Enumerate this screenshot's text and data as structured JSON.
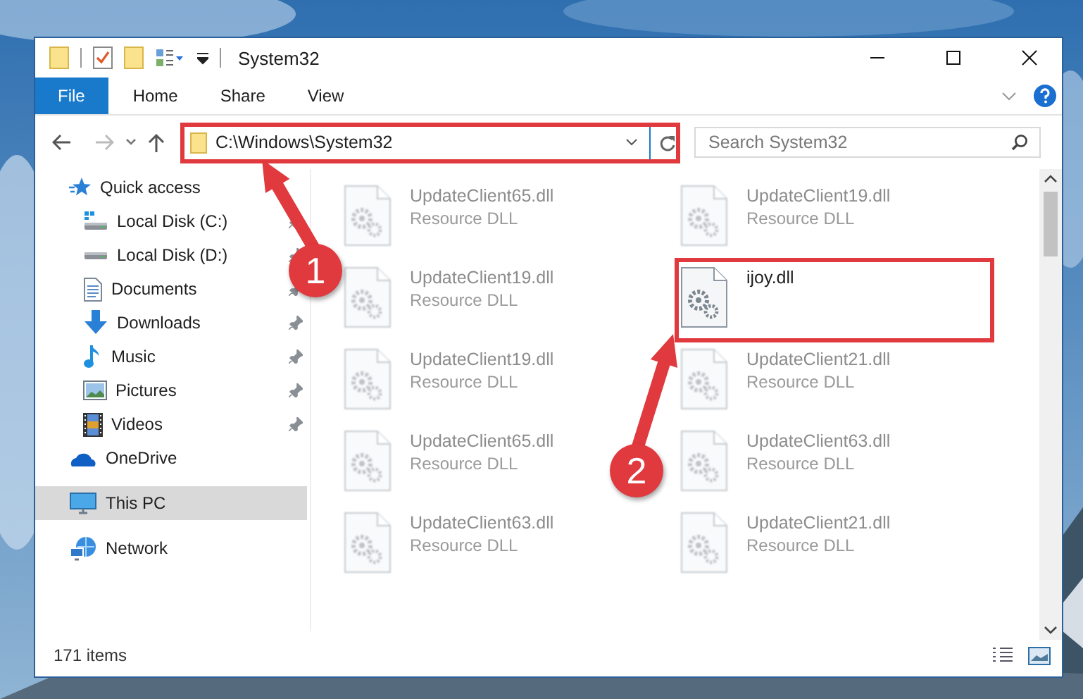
{
  "window": {
    "title": "System32"
  },
  "ribbon_tabs": [
    {
      "label": "File",
      "kind": "backstage",
      "selected": false
    },
    {
      "label": "Home",
      "kind": "tab",
      "selected": false
    },
    {
      "label": "Share",
      "kind": "tab",
      "selected": false
    },
    {
      "label": "View",
      "kind": "tab",
      "selected": false
    }
  ],
  "address": {
    "path": "C:\\Windows\\System32",
    "highlighted": true
  },
  "search": {
    "placeholder": "Search System32"
  },
  "navigation": [
    {
      "label": "Quick access",
      "kind": "star",
      "selected": false,
      "children": [
        {
          "label": "Local Disk (C:)",
          "kind": "drive-windows",
          "pinned": true,
          "selected": false
        },
        {
          "label": "Local Disk (D:)",
          "kind": "drive",
          "pinned": true,
          "selected": false
        },
        {
          "label": "Documents",
          "kind": "document",
          "pinned": true,
          "selected": false
        },
        {
          "label": "Downloads",
          "kind": "download",
          "pinned": true,
          "selected": false
        },
        {
          "label": "Music",
          "kind": "music",
          "pinned": true,
          "selected": false
        },
        {
          "label": "Pictures",
          "kind": "pictures",
          "pinned": true,
          "selected": false
        },
        {
          "label": "Videos",
          "kind": "videos",
          "pinned": true,
          "selected": false
        }
      ]
    },
    {
      "label": "OneDrive",
      "kind": "cloud",
      "selected": false
    },
    {
      "label": "This PC",
      "kind": "computer",
      "selected": true
    },
    {
      "label": "Network",
      "kind": "network",
      "selected": false
    }
  ],
  "files": [
    {
      "name": "UpdateClient65.dll",
      "type": "Resource DLL",
      "blurred": true,
      "highlighted": false
    },
    {
      "name": "UpdateClient19.dll",
      "type": "Resource DLL",
      "blurred": true,
      "highlighted": false
    },
    {
      "name": "UpdateClient19.dll",
      "type": "Resource DLL",
      "blurred": true,
      "highlighted": false
    },
    {
      "name": "ijoy.dll",
      "blurred": false,
      "highlighted": true
    },
    {
      "name": "UpdateClient19.dll",
      "type": "Resource DLL",
      "blurred": true,
      "highlighted": false
    },
    {
      "name": "UpdateClient21.dll",
      "type": "Resource DLL",
      "blurred": true,
      "highlighted": false
    },
    {
      "name": "UpdateClient65.dll",
      "type": "Resource DLL",
      "blurred": true,
      "highlighted": false
    },
    {
      "name": "UpdateClient63.dll",
      "type": "Resource DLL",
      "blurred": true,
      "highlighted": false
    },
    {
      "name": "UpdateClient63.dll",
      "type": "Resource DLL",
      "blurred": true,
      "highlighted": false
    },
    {
      "name": "UpdateClient21.dll",
      "type": "Resource DLL",
      "blurred": true,
      "highlighted": false
    }
  ],
  "status_bar": {
    "item_count": "171 items"
  },
  "callouts": [
    {
      "number": "1"
    },
    {
      "number": "2"
    }
  ]
}
